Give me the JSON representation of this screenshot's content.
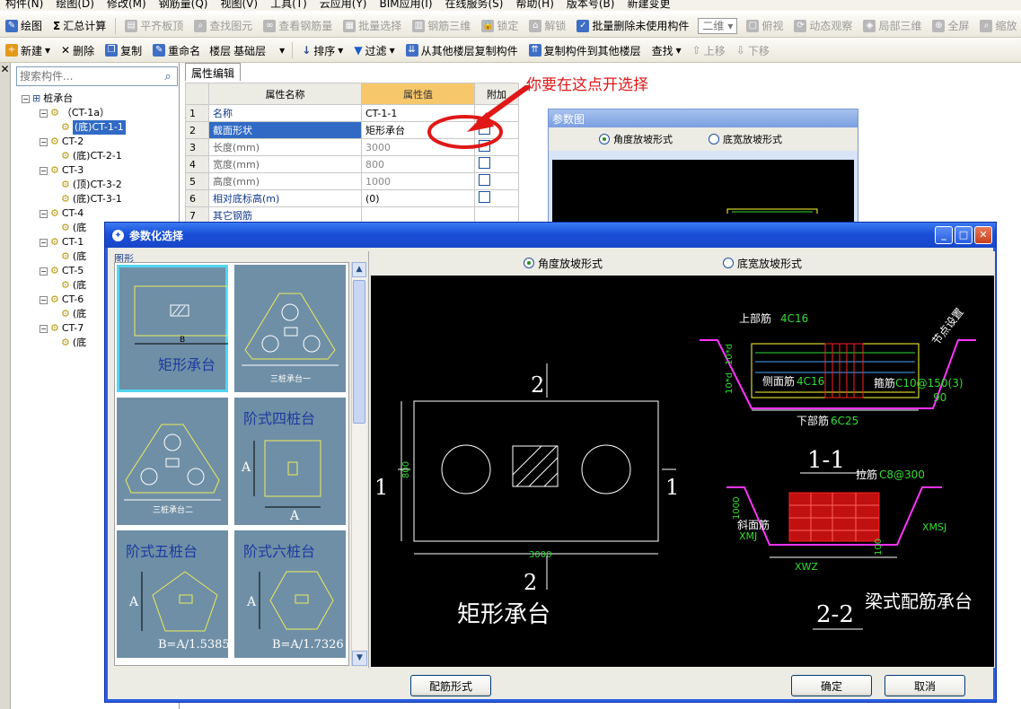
{
  "menubar": [
    "构件(N)",
    "绘图(D)",
    "修改(M)",
    "钢筋量(Q)",
    "视图(V)",
    "工具(T)",
    "云应用(Y)",
    "BIM应用(I)",
    "在线服务(S)",
    "帮助(H)",
    "版本号(B)",
    "新建变更"
  ],
  "toolbar1": {
    "items": [
      "绘图",
      "汇总计算",
      "平齐板顶",
      "查找图元",
      "查看钢筋量",
      "批量选择",
      "钢筋三维",
      "锁定",
      "解锁",
      "批量删除未使用构件"
    ],
    "view_combo": "二维",
    "items2": [
      "俯视",
      "动态观察",
      "局部三维",
      "全屏",
      "缩放"
    ]
  },
  "toolbar2": {
    "items": [
      "新建",
      "删除",
      "复制",
      "重命名"
    ],
    "floor_label": "楼层",
    "floor_value": "基础层",
    "items2": [
      "排序",
      "过滤",
      "从其他楼层复制构件",
      "复制构件到其他楼层",
      "查找",
      "上移",
      "下移"
    ]
  },
  "left_strip": {
    "close": "✕"
  },
  "tree": {
    "search_placeholder": "搜索构件...",
    "root": "桩承台",
    "nodes": [
      {
        "label": "（CT-1a）",
        "level": 1
      },
      {
        "label": "(底)CT-1-1",
        "level": 2,
        "selected": true
      },
      {
        "label": "CT-2",
        "level": 1
      },
      {
        "label": "(底)CT-2-1",
        "level": 2
      },
      {
        "label": "CT-3",
        "level": 1
      },
      {
        "label": "(顶)CT-3-2",
        "level": 2
      },
      {
        "label": "(底)CT-3-1",
        "level": 2
      },
      {
        "label": "CT-4",
        "level": 1
      },
      {
        "label": "(底",
        "level": 2
      },
      {
        "label": "CT-1",
        "level": 1
      },
      {
        "label": "(底",
        "level": 2
      },
      {
        "label": "CT-5",
        "level": 1
      },
      {
        "label": "(底",
        "level": 2
      },
      {
        "label": "CT-6",
        "level": 1
      },
      {
        "label": "(底",
        "level": 2
      },
      {
        "label": "CT-7",
        "level": 1
      },
      {
        "label": "(底",
        "level": 2
      }
    ]
  },
  "property_editor": {
    "tab": "属性编辑",
    "headers": {
      "name": "属性名称",
      "value": "属性值",
      "extra": "附加"
    },
    "rows": [
      {
        "num": "1",
        "name": "名称",
        "value": "CT-1-1",
        "checkbox": false,
        "grey": false
      },
      {
        "num": "2",
        "name": "截面形状",
        "value": "矩形承台",
        "checkbox": true,
        "grey": false,
        "selected": true
      },
      {
        "num": "3",
        "name": "长度(mm)",
        "value": "3000",
        "checkbox": true,
        "grey": true
      },
      {
        "num": "4",
        "name": "宽度(mm)",
        "value": "800",
        "checkbox": true,
        "grey": true
      },
      {
        "num": "5",
        "name": "高度(mm)",
        "value": "1000",
        "checkbox": true,
        "grey": true
      },
      {
        "num": "6",
        "name": "相对底标高(m)",
        "value": "(0)",
        "checkbox": true,
        "grey": false
      },
      {
        "num": "7",
        "name": "其它钢筋",
        "value": "",
        "checkbox": false,
        "grey": false
      }
    ]
  },
  "annotation": {
    "text": "你要在这点开选择",
    "color": "#e01818"
  },
  "bg_window": {
    "title": "参数图",
    "radio_angle": "角度放坡形式",
    "radio_width": "底宽放坡形式"
  },
  "dialog": {
    "title": "参数化选择",
    "group_label": "图形",
    "shapes": [
      {
        "caption": "矩形承台",
        "sub": ""
      },
      {
        "caption": "",
        "sub": "三桩承台一"
      },
      {
        "caption": "",
        "sub": "三桩承台二"
      },
      {
        "caption": "阶式四桩台",
        "sub": ""
      },
      {
        "caption": "阶式五桩台",
        "sub": "B=A/1.5385"
      },
      {
        "caption": "阶式六桩台",
        "sub": "B=A/1.7326"
      }
    ],
    "radio_angle": "角度放坡形式",
    "radio_width": "底宽放坡形式",
    "preview": {
      "plan_title": "矩形承台",
      "section_top": "2",
      "section_bottom": "2",
      "section_left": "1",
      "section_right": "1",
      "dim_width": "800",
      "dim_length": "3000",
      "label_top_bar": "上部筋",
      "top_bar_val": "4C16",
      "label_side_bar": "侧面筋",
      "side_bar_val": "4C16",
      "label_stirrup": "箍筋",
      "stirrup_val": "C10@150(3)",
      "label_bottom_bar": "下部筋",
      "bottom_bar_val": "6C25",
      "label_slope": "节点设置",
      "slope_angle": "90",
      "dim_left_1": "10*d",
      "dim_left_2": "10*d",
      "section_1_1": "1-1",
      "label_tie": "拉筋",
      "tie_val": "C8@300",
      "label_slope_bar": "斜面筋",
      "xmj": "XMJ",
      "xmsj": "XMSJ",
      "xwz": "XWZ",
      "dim_1000": "1000",
      "dim_100": "100",
      "section_2_2": "2-2",
      "beam_title": "梁式配筋承台"
    },
    "btn_rebar": "配筋形式",
    "btn_ok": "确定",
    "btn_cancel": "取消"
  },
  "colors": {
    "title_bar": "#1a4fd8",
    "selection": "#316ac5",
    "cad_background": "#000000",
    "cad_line": "#ffffff",
    "cad_green": "#33dd33",
    "cad_red": "#ff2020",
    "cad_magenta": "#ff33ff",
    "cad_yellow": "#ffff33",
    "thumb_bg": "#6f8fa6",
    "thumb_line": "#ecec5a"
  }
}
